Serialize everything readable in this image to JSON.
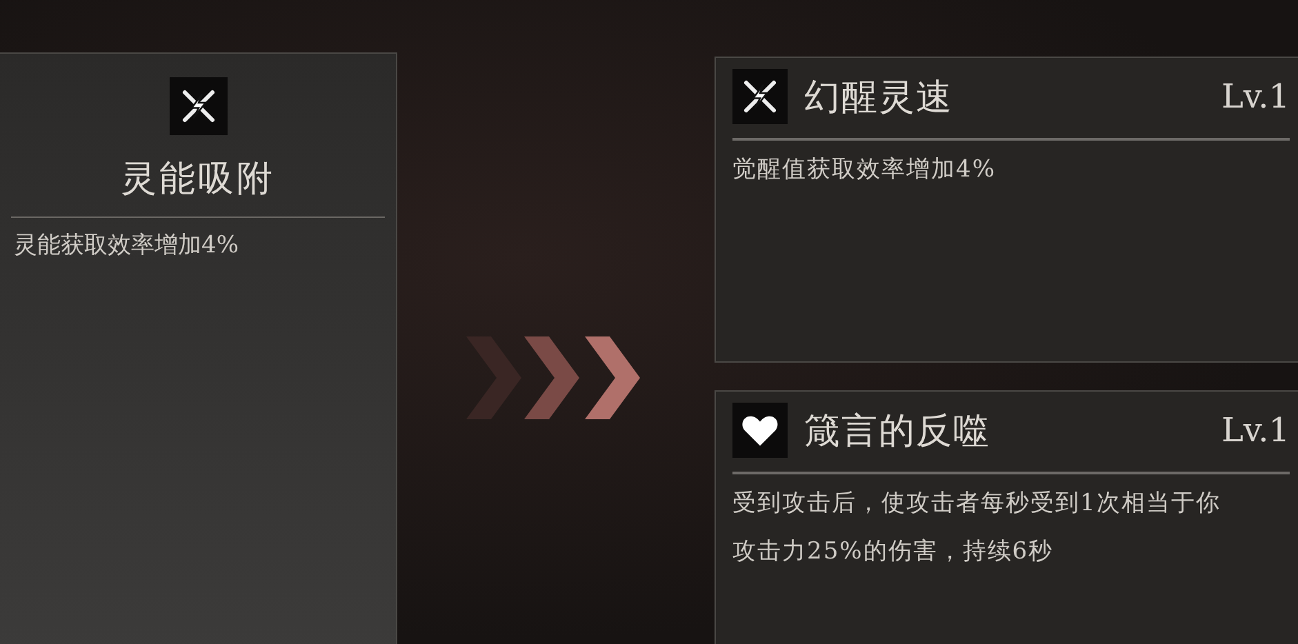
{
  "current": {
    "kind": "bolt",
    "name": "灵能吸附",
    "desc": "灵能获取效率增加4%"
  },
  "options": [
    {
      "kind": "bolt",
      "name": "幻醒灵速",
      "level": "Lv.1",
      "desc": "觉醒值获取效率增加4%"
    },
    {
      "kind": "heart",
      "name": "箴言的反噬",
      "level": "Lv.1",
      "desc": "受到攻击后，使攻击者每秒受到1次相当于你攻击力25%的伤害，持续6秒"
    }
  ]
}
